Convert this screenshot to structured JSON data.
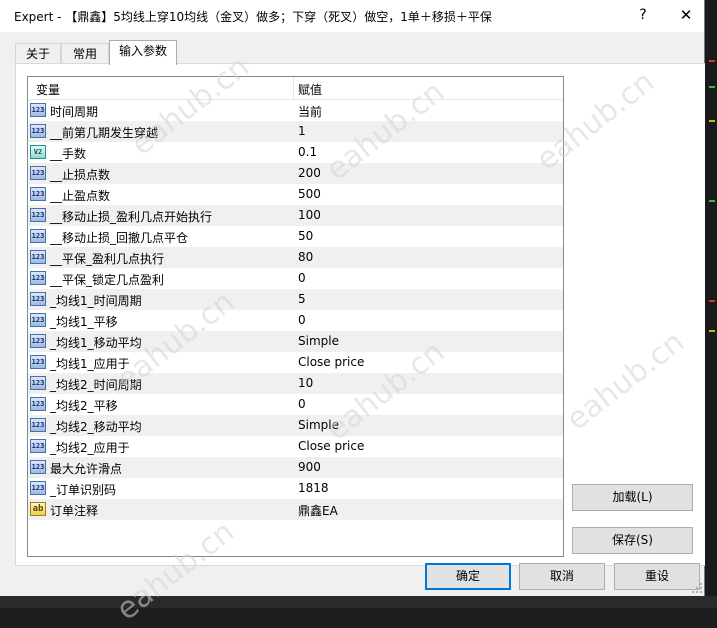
{
  "window": {
    "title": "Expert - 【鼎鑫】5均线上穿10均线（金叉）做多；下穿（死叉）做空，1单＋移损＋平保",
    "help_glyph": "?",
    "close_glyph": "✕"
  },
  "tabs": [
    {
      "label": "关于",
      "active": false
    },
    {
      "label": "常用",
      "active": false
    },
    {
      "label": "输入参数",
      "active": true
    }
  ],
  "table": {
    "headers": {
      "variable": "变量",
      "value": "赋值"
    },
    "rows": [
      {
        "icon": "int-icon",
        "name": "时间周期",
        "value": "当前"
      },
      {
        "icon": "int-icon",
        "name": "__前第几期发生穿越",
        "value": "1"
      },
      {
        "icon": "double-icon",
        "name": "__手数",
        "value": "0.1"
      },
      {
        "icon": "int-icon",
        "name": "__止损点数",
        "value": "200"
      },
      {
        "icon": "int-icon",
        "name": "__止盈点数",
        "value": "500"
      },
      {
        "icon": "int-icon",
        "name": "__移动止损_盈利几点开始执行",
        "value": "100"
      },
      {
        "icon": "int-icon",
        "name": "__移动止损_回撤几点平仓",
        "value": "50"
      },
      {
        "icon": "int-icon",
        "name": "__平保_盈利几点执行",
        "value": "80"
      },
      {
        "icon": "int-icon",
        "name": "__平保_锁定几点盈利",
        "value": "0"
      },
      {
        "icon": "int-icon",
        "name": "_均线1_时间周期",
        "value": "5"
      },
      {
        "icon": "int-icon",
        "name": "_均线1_平移",
        "value": "0"
      },
      {
        "icon": "int-icon",
        "name": "_均线1_移动平均",
        "value": "Simple"
      },
      {
        "icon": "int-icon",
        "name": "_均线1_应用于",
        "value": "Close price"
      },
      {
        "icon": "int-icon",
        "name": "_均线2_时间周期",
        "value": "10"
      },
      {
        "icon": "int-icon",
        "name": "_均线2_平移",
        "value": "0"
      },
      {
        "icon": "int-icon",
        "name": "_均线2_移动平均",
        "value": "Simple"
      },
      {
        "icon": "int-icon",
        "name": "_均线2_应用于",
        "value": "Close price"
      },
      {
        "icon": "int-icon",
        "name": "最大允许滑点",
        "value": "900"
      },
      {
        "icon": "int-icon",
        "name": "_订单识别码",
        "value": "1818"
      },
      {
        "icon": "string-icon",
        "name": "订单注释",
        "value": "鼎鑫EA"
      }
    ]
  },
  "icon_glyphs": {
    "int-icon": "123",
    "double-icon": "V2",
    "string-icon": "ab"
  },
  "buttons": {
    "load": "加载(L)",
    "save": "保存(S)",
    "ok": "确定",
    "cancel": "取消",
    "reset": "重设"
  },
  "watermark": "eahub.cn",
  "colors": {
    "accent": "#0078d7",
    "alt_row": "#f0f0f0"
  }
}
